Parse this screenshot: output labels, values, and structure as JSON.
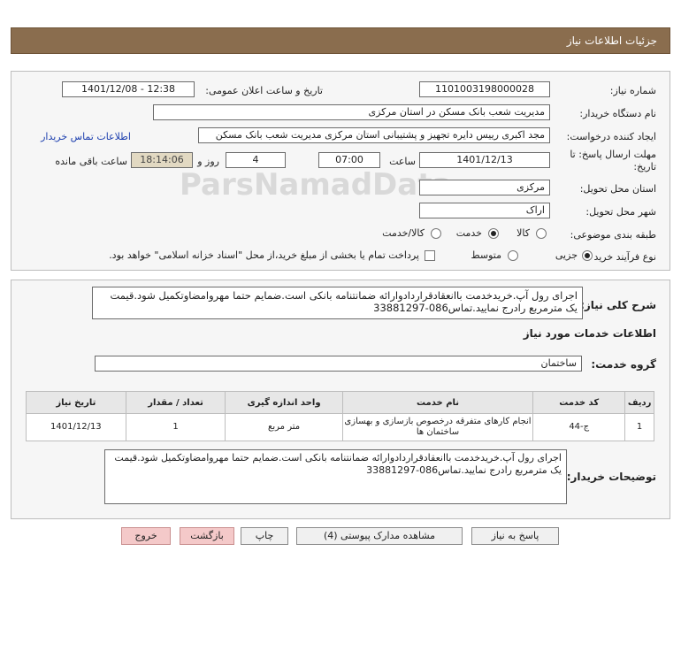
{
  "page": {
    "title": "جزئیات اطلاعات نیاز"
  },
  "form": {
    "need_number": {
      "label": "شماره نیاز:",
      "value": "1101003198000028"
    },
    "announce_datetime": {
      "label": "تاریخ و ساعت اعلان عمومی:",
      "value": "1401/12/08 - 12:38"
    },
    "buyer_org": {
      "label": "نام دستگاه خریدار:",
      "value": "مدیریت شعب بانک مسکن در استان مرکزی"
    },
    "requester": {
      "label": "ایجاد کننده درخواست:",
      "value": "مجد اکبری رییس دایره تجهیز و پشتیبانی استان مرکزی مدیریت شعب بانک مسکن",
      "contact_link": "اطلاعات تماس خریدار"
    },
    "deadline": {
      "label_line1": "مهلت ارسال پاسخ: تا",
      "label_line2": "تاریخ:",
      "date": "1401/12/13",
      "time_label": "ساعت",
      "time": "07:00",
      "days": "4",
      "days_label": "روز و",
      "remaining": "18:14:06",
      "remaining_label": "ساعت باقی مانده"
    },
    "delivery_province": {
      "label": "استان محل تحویل:",
      "value": "مرکزی"
    },
    "delivery_city": {
      "label": "شهر محل تحویل:",
      "value": "اراک"
    },
    "category": {
      "label": "طبقه بندی موضوعی:",
      "options": [
        "کالا",
        "خدمت",
        "کالا/خدمت"
      ],
      "selected": "خدمت"
    },
    "process": {
      "label": "نوع فرآیند خرید :",
      "options": [
        "جزیی",
        "متوسط"
      ],
      "selected": "جزیی",
      "payment_note": "پرداخت تمام یا بخشی از مبلغ خرید،از محل \"اسناد خزانه اسلامی\" خواهد بود."
    }
  },
  "summary": {
    "label": "شرح کلی نیاز:",
    "text": "اجرای رول آپ.خریدخدمت باانعقادقراردادوارائه ضمانتنامه بانکی است.ضمایم حتما مهروامضاوتکمیل شود.قیمت یک مترمربع رادرج نمایید.تماس086-33881297"
  },
  "services": {
    "title": "اطلاعات خدمات مورد نیاز",
    "group_label": "گروه خدمت:",
    "group_value": "ساختمان",
    "columns": [
      "ردیف",
      "کد خدمت",
      "نام خدمت",
      "واحد اندازه گیری",
      "تعداد / مقدار",
      "تاریخ نیاز"
    ],
    "rows": [
      {
        "index": "1",
        "code": "ج-44",
        "name": "انجام کارهای متفرقه درخصوص بازسازی و بهسازی ساختمان ها",
        "unit": "متر مربع",
        "qty": "1",
        "date": "1401/12/13"
      }
    ]
  },
  "buyer_notes": {
    "label": "توضیحات خریدار:",
    "text": "اجرای رول آپ.خریدخدمت باانعقادقراردادوارائه ضمانتنامه بانکی است.ضمایم حتما مهروامضاوتکمیل شود.قیمت یک مترمربع رادرج نمایید.تماس086-33881297"
  },
  "buttons": {
    "reply": "پاسخ به نیاز",
    "attachments": "مشاهده مدارک پیوستی (4)",
    "print": "چاپ",
    "back": "بازگشت",
    "exit": "خروج"
  },
  "watermark": {
    "brand": "ParsNamadData"
  }
}
